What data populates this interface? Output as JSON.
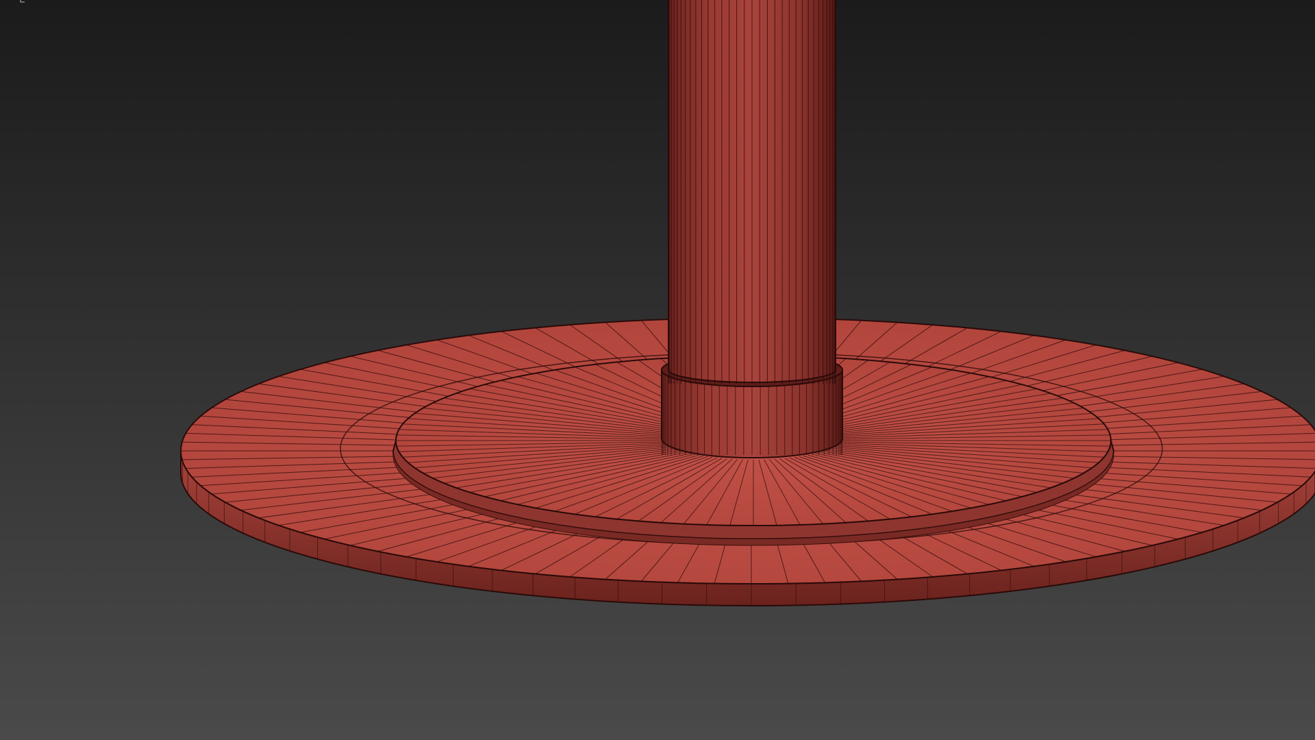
{
  "viewport": {
    "background_top_color": "#1b1b1b",
    "background_bottom_color": "#4a4a4a",
    "render_mode": "shaded-with-wireframe"
  },
  "model": {
    "object": "pedestal-table-base",
    "parts": [
      "column",
      "column-collar",
      "base-plate",
      "base-raised-ring"
    ],
    "surface_color": "#b9493f",
    "surface_shadow_color": "#7a2a25",
    "wire_color": "#2a0a08"
  }
}
